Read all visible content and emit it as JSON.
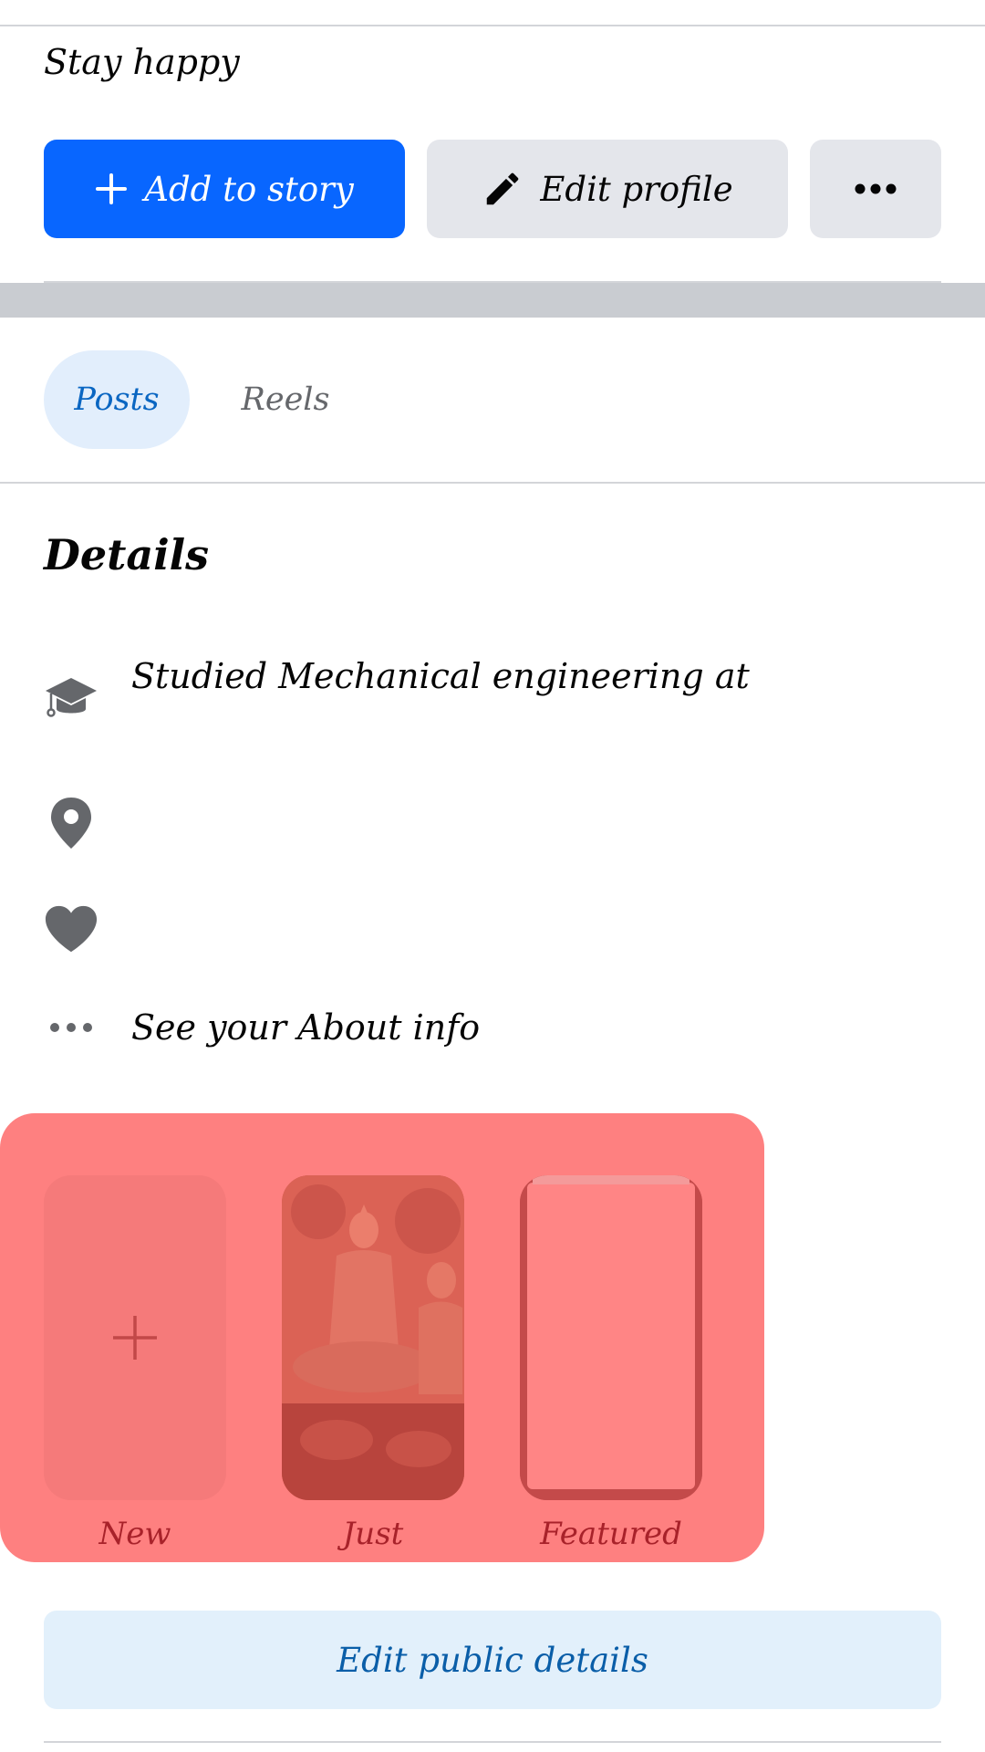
{
  "profile": {
    "bio": "Stay happy"
  },
  "actions": {
    "add_story_label": "Add to story",
    "edit_profile_label": "Edit profile",
    "more_icon": "more-horizontal-icon",
    "primary_color": "#0866ff"
  },
  "tabs": [
    {
      "label": "Posts",
      "active": true
    },
    {
      "label": "Reels",
      "active": false
    }
  ],
  "details": {
    "title": "Details",
    "items": [
      {
        "icon": "graduation-cap-icon",
        "text": "Studied Mechanical engineering at"
      },
      {
        "icon": "location-pin-icon",
        "text": ""
      },
      {
        "icon": "heart-icon",
        "text": ""
      },
      {
        "icon": "more-horizontal-icon",
        "text": "See your About info"
      }
    ]
  },
  "highlights": {
    "overlay_color": "#fe8080",
    "items": [
      {
        "label": "New",
        "icon": "plus-icon"
      },
      {
        "label": "Just"
      },
      {
        "label": "Featured"
      }
    ]
  },
  "footer": {
    "edit_public_label": "Edit public details"
  }
}
